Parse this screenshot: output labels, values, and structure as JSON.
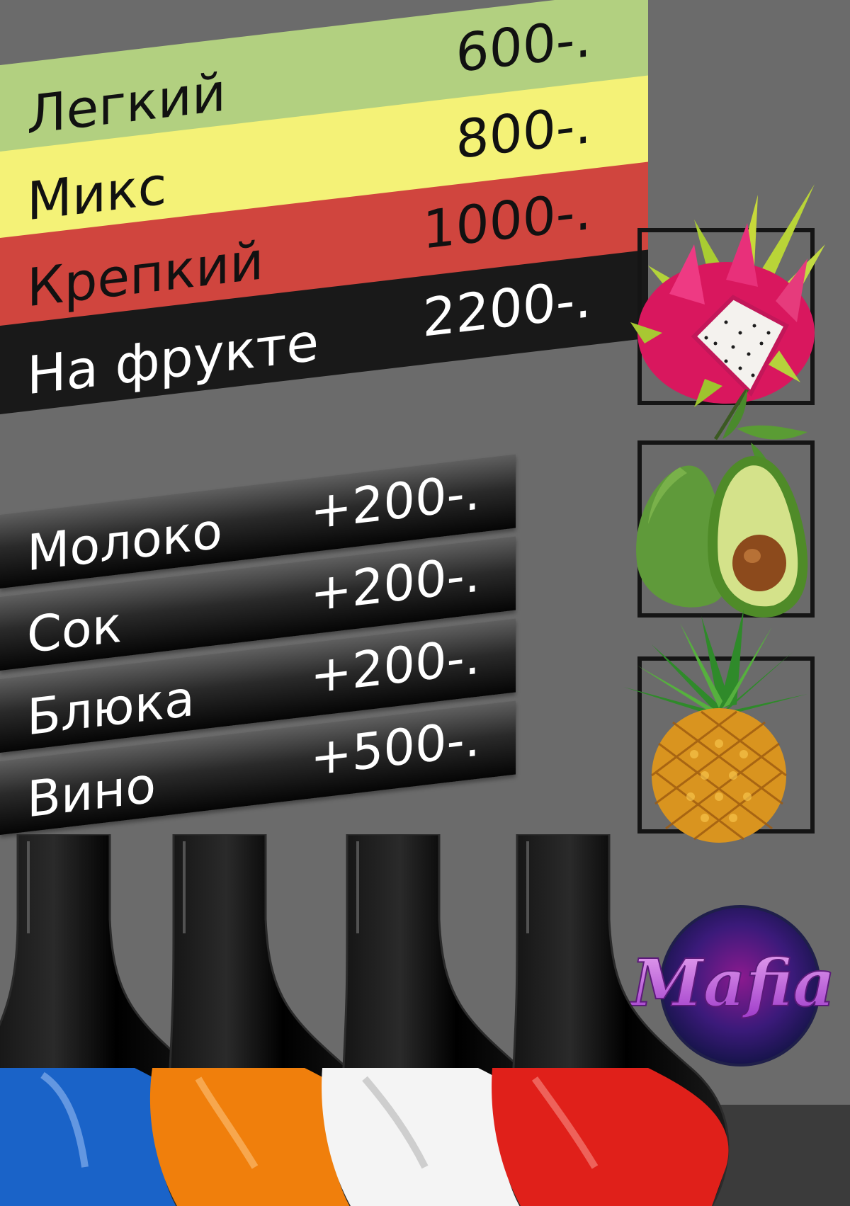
{
  "tiers": [
    {
      "name": "Легкий",
      "price": "600-.",
      "color": "#b2d080"
    },
    {
      "name": "Микс",
      "price": "800-.",
      "color": "#f4f277"
    },
    {
      "name": "Крепкий",
      "price": "1000-.",
      "color": "#d0453e"
    },
    {
      "name": "На фрукте",
      "price": "2200-.",
      "color": "#191919"
    }
  ],
  "addons": [
    {
      "name": "Молоко",
      "price": "+200-."
    },
    {
      "name": "Сок",
      "price": "+200-."
    },
    {
      "name": "Блюка",
      "price": "+200-."
    },
    {
      "name": "Вино",
      "price": "+500-."
    }
  ],
  "fruits": [
    "dragon-fruit-icon",
    "avocado-icon",
    "pineapple-icon"
  ],
  "logo": {
    "text": "Mafia",
    "colors": [
      "#7a2aa0",
      "#d36be0"
    ]
  },
  "bottles": [
    {
      "liquid": "#1a63c8"
    },
    {
      "liquid": "#f07f0c"
    },
    {
      "liquid": "#f4f4f4"
    },
    {
      "liquid": "#e0201a"
    }
  ],
  "theme": {
    "background": "#6b6b6b"
  }
}
